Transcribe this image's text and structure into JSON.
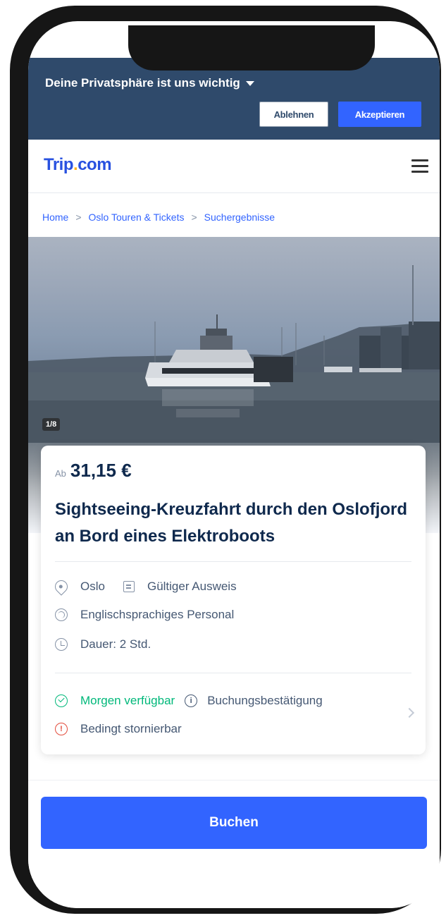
{
  "privacy": {
    "title": "Deine Privatsphäre ist uns wichtig",
    "decline_label": "Ablehnen",
    "accept_label": "Akzeptieren"
  },
  "header": {
    "logo_trip": "Trip",
    "logo_dot": ".",
    "logo_com": "com",
    "menu_icon": "hamburger-menu-icon"
  },
  "breadcrumb": {
    "items": [
      "Home",
      "Oslo Touren & Tickets",
      "Suchergebnisse"
    ],
    "separator": ">"
  },
  "gallery": {
    "counter": "1/8"
  },
  "product": {
    "price_prefix": "Ab",
    "price": "31,15 €",
    "title": "Sightseeing-Kreuzfahrt durch den Oslofjord an Bord eines Elektroboots",
    "location": "Oslo",
    "document": "Gültiger Ausweis",
    "language": "Englischsprachiges Personal",
    "duration": "Dauer: 2 Std.",
    "availability": "Morgen verfügbar",
    "confirmation": "Buchungsbestätigung",
    "cancellation": "Bedingt stornierbar"
  },
  "cta": {
    "book_label": "Buchen"
  },
  "colors": {
    "brand_blue": "#3264ff",
    "privacy_bar": "#2f4a6b",
    "available_green": "#00b87a",
    "warning_red": "#e34c3c",
    "text_dark": "#0f294d"
  }
}
